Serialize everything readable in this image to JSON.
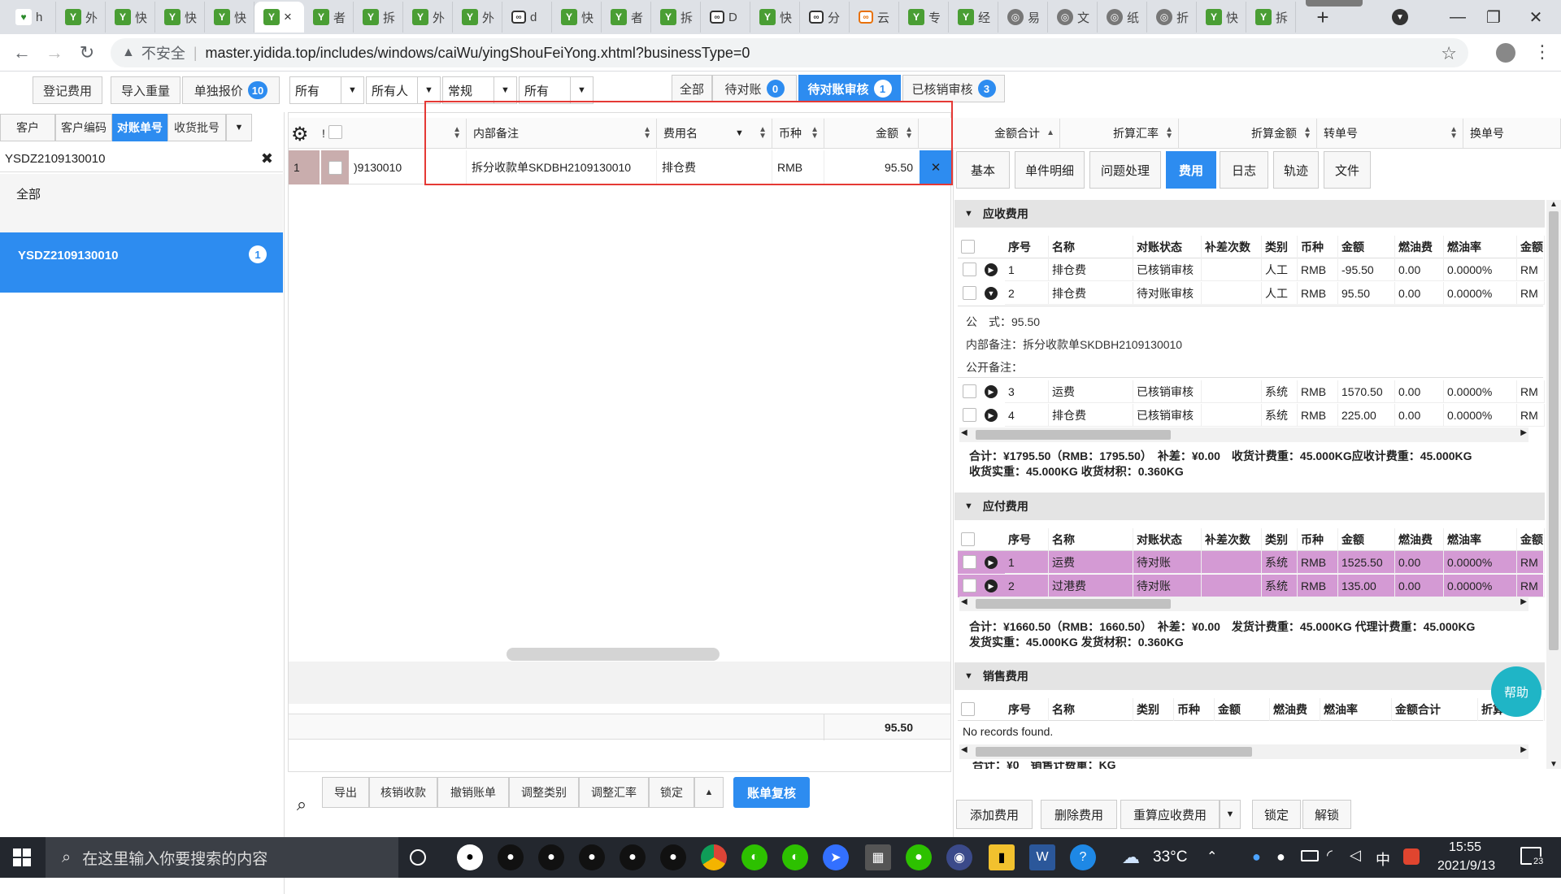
{
  "browser": {
    "tabs": [
      {
        "favicon": "hao-icon",
        "text": "h"
      },
      {
        "favicon": "yidida-icon",
        "text": "外"
      },
      {
        "favicon": "yidida-icon",
        "text": "快"
      },
      {
        "favicon": "yidida-icon",
        "text": "快"
      },
      {
        "favicon": "yidida-icon",
        "text": "快"
      },
      {
        "favicon": "yidida-icon",
        "text": "×"
      },
      {
        "favicon": "yidida-icon",
        "text": "者"
      },
      {
        "favicon": "yidida-icon",
        "text": "拆"
      },
      {
        "favicon": "yidida-icon",
        "text": "外"
      },
      {
        "favicon": "yidida-icon",
        "text": "外"
      },
      {
        "favicon": "link-icon",
        "text": "d"
      },
      {
        "favicon": "yidida-icon",
        "text": "快"
      },
      {
        "favicon": "yidida-icon",
        "text": "者"
      },
      {
        "favicon": "yidida-icon",
        "text": "拆"
      },
      {
        "favicon": "link-icon",
        "text": "D"
      },
      {
        "favicon": "yidida-icon",
        "text": "快"
      },
      {
        "favicon": "link-icon",
        "text": "分"
      },
      {
        "favicon": "link-orange-icon",
        "text": "云"
      },
      {
        "favicon": "yidida-icon",
        "text": "专"
      },
      {
        "favicon": "yidida-icon",
        "text": "经"
      },
      {
        "favicon": "globe-icon",
        "text": "易"
      },
      {
        "favicon": "globe-icon",
        "text": "文"
      },
      {
        "favicon": "globe-icon",
        "text": "纸"
      },
      {
        "favicon": "globe-icon",
        "text": "折"
      },
      {
        "favicon": "yidida-icon",
        "text": "快"
      },
      {
        "favicon": "yidida-icon",
        "text": "拆"
      }
    ],
    "active_tab": 5,
    "new_tab": "+",
    "insecure": "不安全",
    "url": "master.yidida.top/includes/windows/caiWu/yingShouFeiYong.xhtml?businessType=0"
  },
  "toolbar": {
    "register_fee": "登记费用",
    "import_weight": "导入重量",
    "single_quote": "单独报价",
    "single_quote_count": "10",
    "filter1": "所有",
    "filter2": "所有人",
    "filter3": "常规",
    "filter4": "所有",
    "status_tabs": [
      {
        "label": "全部",
        "count": ""
      },
      {
        "label": "待对账",
        "count": "0"
      },
      {
        "label": "待对账审核",
        "count": "1"
      },
      {
        "label": "已核销审核",
        "count": "3"
      }
    ]
  },
  "left": {
    "tabs": [
      "客户",
      "客户编码",
      "对账单号",
      "收货批号"
    ],
    "active_tab": 2,
    "search_value": "YSDZ2109130010",
    "all_label": "全部",
    "selected_item": "YSDZ2109130010",
    "selected_count": "1"
  },
  "grid": {
    "columns": [
      "!",
      "内部备注",
      "费用名",
      "币种",
      "金额",
      "金额合计",
      "折算汇率",
      "折算金额",
      "转单号",
      "换单号"
    ],
    "row": {
      "index": "1",
      "bill_no_fragment": ")9130010",
      "internal_note": "拆分收款单SKDBH2109130010",
      "fee_name": "排仓费",
      "currency": "RMB",
      "amount": "95.50"
    },
    "footer_total": "95.50",
    "actions": [
      "导出",
      "核销收款",
      "撤销账单",
      "调整类别",
      "调整汇率",
      "锁定"
    ],
    "primary_action": "账单复核"
  },
  "right": {
    "tabs": [
      "基本",
      "单件明细",
      "问题处理",
      "费用",
      "日志",
      "轨迹",
      "文件"
    ],
    "active_tab": 3,
    "receivable": {
      "title": "应收费用",
      "headers": [
        "序号",
        "名称",
        "对账状态",
        "补差次数",
        "类别",
        "币种",
        "金额",
        "燃油费",
        "燃油率",
        "金额"
      ],
      "rows": [
        {
          "no": "1",
          "name": "排仓费",
          "status": "已核销审核",
          "diff": "",
          "cat": "人工",
          "cur": "RMB",
          "amt": "-95.50",
          "fuel": "0.00",
          "rate": "0.0000%",
          "x": "RM",
          "expanded": false
        },
        {
          "no": "2",
          "name": "排仓费",
          "status": "待对账审核",
          "diff": "",
          "cat": "人工",
          "cur": "RMB",
          "amt": "95.50",
          "fuel": "0.00",
          "rate": "0.0000%",
          "x": "RM",
          "expanded": true
        }
      ],
      "formula": "公　式：95.50",
      "internal_note": "内部备注：拆分收款单SKDBH2109130010",
      "public_note": "公开备注：",
      "rows2": [
        {
          "no": "3",
          "name": "运费",
          "status": "已核销审核",
          "diff": "",
          "cat": "系统",
          "cur": "RMB",
          "amt": "1570.50",
          "fuel": "0.00",
          "rate": "0.0000%",
          "x": "RM"
        },
        {
          "no": "4",
          "name": "排仓费",
          "status": "已核销审核",
          "diff": "",
          "cat": "系统",
          "cur": "RMB",
          "amt": "225.00",
          "fuel": "0.00",
          "rate": "0.0000%",
          "x": "RM"
        }
      ],
      "summary_line1": "合计：¥1795.50（RMB：1795.50）　补差：¥0.00　收货计费重：45.000KG应收计费重：45.000KG",
      "summary_line2": "收货实重：45.000KG 收货材积：0.360KG"
    },
    "payable": {
      "title": "应付费用",
      "headers": [
        "序号",
        "名称",
        "对账状态",
        "补差次数",
        "类别",
        "币种",
        "金额",
        "燃油费",
        "燃油率",
        "金额"
      ],
      "rows": [
        {
          "no": "1",
          "name": "运费",
          "status": "待对账",
          "diff": "",
          "cat": "系统",
          "cur": "RMB",
          "amt": "1525.50",
          "fuel": "0.00",
          "rate": "0.0000%",
          "x": "RM"
        },
        {
          "no": "2",
          "name": "过港费",
          "status": "待对账",
          "diff": "",
          "cat": "系统",
          "cur": "RMB",
          "amt": "135.00",
          "fuel": "0.00",
          "rate": "0.0000%",
          "x": "RM"
        }
      ],
      "summary_line1": "合计：¥1660.50（RMB：1660.50）　补差：¥0.00　发货计费重：45.000KG 代理计费重：45.000KG",
      "summary_line2": "发货实重：45.000KG 发货材积：0.360KG"
    },
    "sales": {
      "title": "销售费用",
      "headers": [
        "序号",
        "名称",
        "类别",
        "币种",
        "金额",
        "燃油费",
        "燃油率",
        "金额合计",
        "折算"
      ],
      "empty": "No records found.",
      "summary_partial": "合计：¥0　销售计费重：KG"
    },
    "help": "帮助",
    "bottom_buttons": [
      "添加费用",
      "删除费用",
      "重算应收费用",
      "锁定",
      "解锁"
    ]
  },
  "taskbar": {
    "search_placeholder": "在这里输入你要搜索的内容",
    "weather": "33°C",
    "ime": "中",
    "time": "15:55",
    "date": "2021/9/13",
    "notifications": "23"
  },
  "colors": {
    "accent": "#2d8cf0",
    "highlight_box": "#e53935",
    "payable_row": "#d49ad4",
    "row_marker": "#b39191"
  }
}
